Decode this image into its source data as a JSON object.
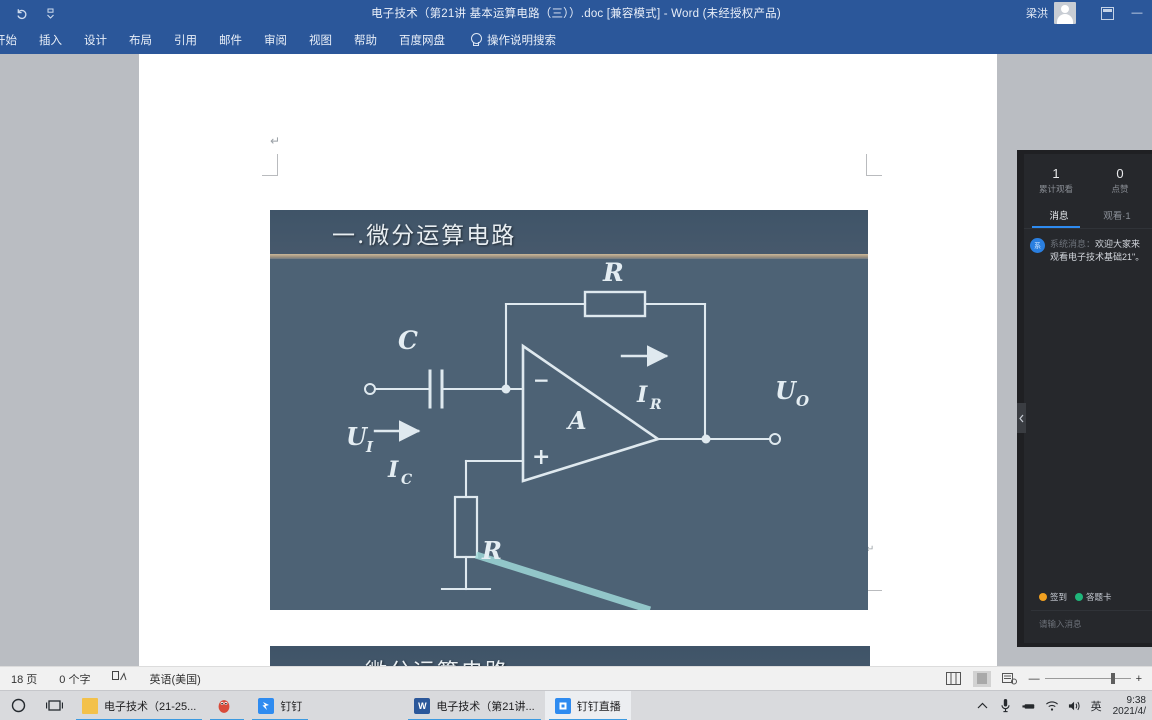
{
  "window": {
    "title": "电子技术（第21讲 基本运算电路（三））.doc [兼容模式]  -  Word (未经授权产品)",
    "account_name": "梁洪",
    "quick_access": [
      "undo-icon",
      "customize-icon"
    ],
    "ribbon_icon": "ribbon-display-options-icon",
    "minimize_label": "—"
  },
  "ribbon": {
    "tabs": [
      {
        "label": "开始"
      },
      {
        "label": "插入"
      },
      {
        "label": "设计"
      },
      {
        "label": "布局"
      },
      {
        "label": "引用"
      },
      {
        "label": "邮件"
      },
      {
        "label": "审阅"
      },
      {
        "label": "视图"
      },
      {
        "label": "帮助"
      },
      {
        "label": "百度网盘"
      }
    ],
    "tell_me": "操作说明搜索"
  },
  "document": {
    "pilcrow": "↵",
    "slides": [
      {
        "title": "一.微分运算电路",
        "circuit": {
          "labels": {
            "capacitor": "C",
            "feedback_resistor": "R",
            "ground_resistor": "R",
            "input": "U",
            "input_sub": "I",
            "output": "U",
            "output_sub": "O",
            "current_cap": "I",
            "current_cap_sub": "C",
            "current_res": "I",
            "current_res_sub": "R",
            "opamp": "A",
            "inverting": "−",
            "noninverting": "+"
          }
        }
      },
      {
        "title": "一.微分运算电路"
      }
    ]
  },
  "status_bar": {
    "page_count": "18 页",
    "word_count": "0 个字",
    "proofing_icon": "proofing-errors-icon",
    "language": "英语(美国)",
    "view_buttons": [
      "print-layout-icon",
      "web-layout-icon",
      "read-mode-icon"
    ],
    "zoom_minus": "—",
    "zoom_plus": "+"
  },
  "live_panel": {
    "stats": [
      {
        "value": "1",
        "label": "累计观看"
      },
      {
        "value": "0",
        "label": "点赞"
      }
    ],
    "tabs": [
      {
        "label": "消息",
        "active": true
      },
      {
        "label": "观看·1",
        "active": false
      }
    ],
    "messages": [
      {
        "avatar_initial": "系",
        "sender": "系统消息：",
        "text": "欢迎大家来观看电子技术基础21\"。"
      }
    ],
    "actions": [
      {
        "label": "签到",
        "icon": "checkin-icon",
        "color": "#f0a020"
      },
      {
        "label": "答题卡",
        "icon": "answer-card-icon",
        "color": "#1fb67a"
      }
    ],
    "input_placeholder": "请输入消息",
    "collapse_icon": "chevron-left-icon"
  },
  "taskbar": {
    "system_icons": [
      "cortana-circle-icon",
      "task-view-icon"
    ],
    "apps": [
      {
        "label": "电子技术（21-25...",
        "icon": "folder-icon",
        "badge": "",
        "active": false
      },
      {
        "label": "",
        "icon": "qq-penguin-icon",
        "badge": "",
        "active": false
      },
      {
        "label": "钉钉",
        "icon": "dingtalk-icon",
        "badge": "",
        "active": false
      },
      {
        "label": "电子技术（第21讲...",
        "icon": "word-icon",
        "badge": "W",
        "active": false
      },
      {
        "label": "钉钉直播",
        "icon": "dingtalk-live-icon",
        "badge": "",
        "active": true
      }
    ],
    "tray_icons": [
      "show-hidden-icons-icon",
      "microphone-icon",
      "usb-icon",
      "wifi-icon",
      "volume-icon"
    ],
    "ime": "英",
    "clock_time": "9:38",
    "clock_date": "2021/4/"
  },
  "colors": {
    "word_blue": "#2b579a",
    "accent_blue": "#2e8bf0",
    "slide_bg": "#4d6275",
    "taskbar": "#d9dadd",
    "panel_bg": "#26282c"
  }
}
